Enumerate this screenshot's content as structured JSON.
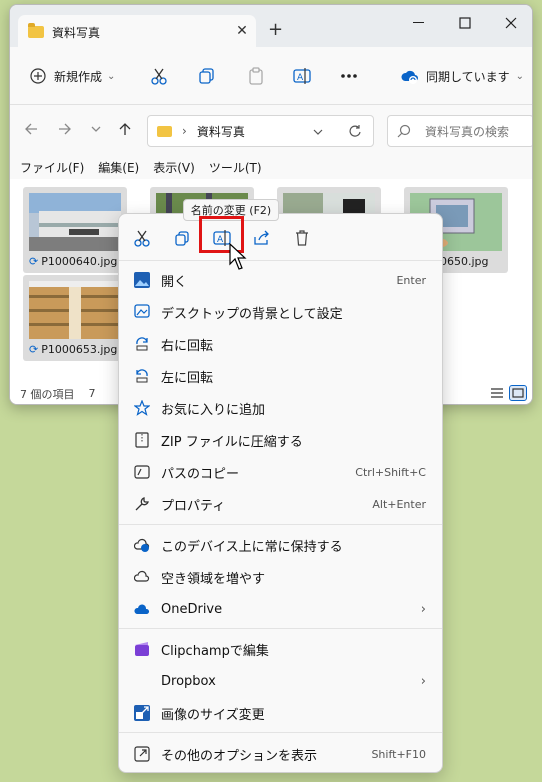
{
  "window": {
    "tab_title": "資料写真",
    "tab_close": "✕",
    "tab_add": "+"
  },
  "toolbar": {
    "new_label": "新規作成",
    "new_chevron": "⌄",
    "sync_label": "同期しています",
    "sync_chevron": "⌄"
  },
  "nav": {
    "breadcrumb_sep": "›",
    "breadcrumb": "資料写真",
    "search_placeholder": "資料写真の検索"
  },
  "menu": {
    "items": [
      "ファイル(F)",
      "編集(E)",
      "表示(V)",
      "ツール(T)"
    ]
  },
  "files": [
    {
      "name": "P1000640.jpg"
    },
    {
      "name": "0650.jpg"
    },
    {
      "name": "P1000653.jpg"
    }
  ],
  "status": {
    "count": "7 個の項目",
    "selected": "7"
  },
  "tooltip": "名前の変更 (F2)",
  "context_menu": {
    "items": [
      {
        "label": "開く",
        "shortcut": "Enter",
        "icon": "photo-icon"
      },
      {
        "label": "デスクトップの背景として設定",
        "shortcut": "",
        "icon": "wallpaper-icon"
      },
      {
        "label": "右に回転",
        "shortcut": "",
        "icon": "rotate-right-icon"
      },
      {
        "label": "左に回転",
        "shortcut": "",
        "icon": "rotate-left-icon"
      },
      {
        "label": "お気に入りに追加",
        "shortcut": "",
        "icon": "star-icon"
      },
      {
        "label": "ZIP ファイルに圧縮する",
        "shortcut": "",
        "icon": "zip-icon"
      },
      {
        "label": "パスのコピー",
        "shortcut": "Ctrl+Shift+C",
        "icon": "path-icon"
      },
      {
        "label": "プロパティ",
        "shortcut": "Alt+Enter",
        "icon": "wrench-icon"
      },
      {
        "label": "このデバイス上に常に保持する",
        "shortcut": "",
        "icon": "keep-cloud-icon"
      },
      {
        "label": "空き領域を増やす",
        "shortcut": "",
        "icon": "cloud-icon"
      },
      {
        "label": "OneDrive",
        "shortcut": "›",
        "icon": "onedrive-icon"
      },
      {
        "label": "Clipchampで編集",
        "shortcut": "",
        "icon": "clipchamp-icon"
      },
      {
        "label": "Dropbox",
        "shortcut": "›",
        "icon": "dropbox-icon"
      },
      {
        "label": "画像のサイズ変更",
        "shortcut": "",
        "icon": "resize-icon"
      },
      {
        "label": "その他のオプションを表示",
        "shortcut": "Shift+F10",
        "icon": "more-options-icon"
      }
    ]
  }
}
